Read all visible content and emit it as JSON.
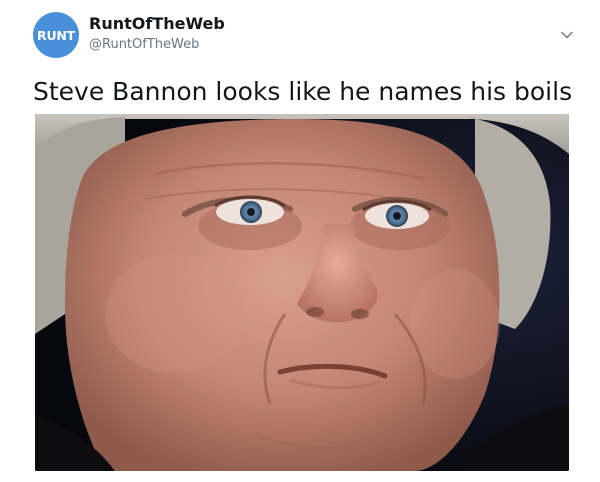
{
  "account": {
    "avatar_text": "RUNT",
    "display_name": "RuntOfTheWeb",
    "handle": "@RuntOfTheWeb"
  },
  "tweet": {
    "text": "Steve Bannon looks like he names his boils"
  },
  "icons": {
    "menu": "chevron-down-icon"
  },
  "colors": {
    "avatar_bg": "#4a90d9",
    "name": "#14171a",
    "handle": "#657786"
  }
}
